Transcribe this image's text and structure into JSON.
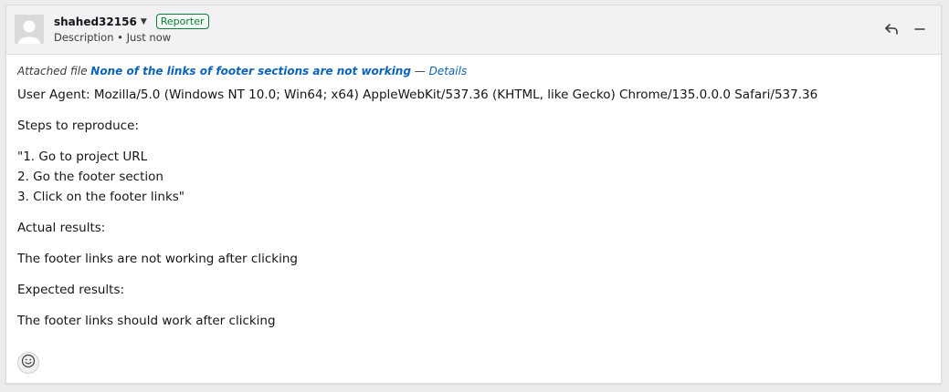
{
  "comment": {
    "author": "shahed32156",
    "role_badge": "Reporter",
    "meta": "Description • Just now"
  },
  "attachment": {
    "prefix": "Attached file",
    "file_name": "None of the links of footer sections are not working",
    "separator": "—",
    "details_link": "Details"
  },
  "body_lines": {
    "user_agent": "User Agent: Mozilla/5.0 (Windows NT 10.0; Win64; x64) AppleWebKit/537.36 (KHTML, like Gecko) Chrome/135.0.0.0 Safari/537.36",
    "steps_heading": "Steps to reproduce:",
    "step1": "\"1. Go to project URL",
    "step2": "2. Go the footer section",
    "step3": "3. Click on the footer links\"",
    "actual_heading": "Actual results:",
    "actual_text": "The footer links are not working after clicking",
    "expected_heading": "Expected results:",
    "expected_text": "The footer links should work after clicking"
  },
  "icons": {
    "avatar": "default-avatar-icon",
    "reply": "reply-arrow-icon",
    "collapse": "minus-icon",
    "reaction": "smiley-face-icon",
    "author_menu": "chevron-down-icon"
  },
  "colors": {
    "link": "#0b63b8",
    "badge": "#117a3d"
  }
}
